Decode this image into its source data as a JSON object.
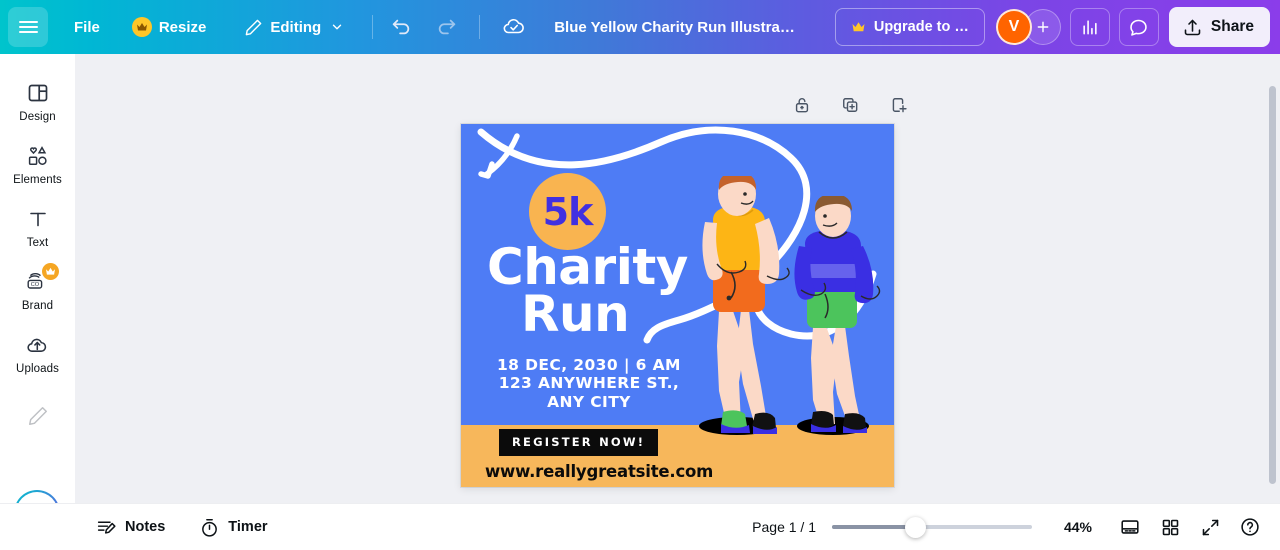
{
  "topbar": {
    "menu_icon": "hamburger-menu-icon",
    "file_label": "File",
    "resize_label": "Resize",
    "resize_pro_icon": "crown-icon",
    "editing_label": "Editing",
    "editing_icon": "pencil-icon",
    "editing_chevron": "chevron-down-icon",
    "undo_icon": "undo-icon",
    "redo_icon": "redo-icon",
    "cloud_icon": "cloud-saved-check-icon",
    "doc_title": "Blue Yellow Charity Run Illustrativ…",
    "upgrade_label": "Upgrade to …",
    "upgrade_icon": "crown-icon",
    "avatar_initial": "V",
    "add_collaborator_icon": "plus-icon",
    "insights_icon": "bar-chart-icon",
    "comment_icon": "speech-bubble-icon",
    "share_label": "Share",
    "share_icon": "upload-share-icon",
    "gradient_start": "#00C4CC",
    "gradient_end": "#8B3DEA"
  },
  "sidebar": {
    "items": [
      {
        "label": "Design",
        "icon": "design-layout-icon",
        "pro": false
      },
      {
        "label": "Elements",
        "icon": "shapes-icon",
        "pro": false
      },
      {
        "label": "Text",
        "icon": "text-t-icon",
        "pro": false
      },
      {
        "label": "Brand",
        "icon": "brand-kit-icon",
        "pro": true
      },
      {
        "label": "Uploads",
        "icon": "upload-cloud-icon",
        "pro": false
      }
    ],
    "draw_icon": "pencil-draw-icon",
    "magic_icon": "magic-sparkles-icon"
  },
  "page_tools": {
    "lock_icon": "unlock-padlock-icon",
    "duplicate_icon": "duplicate-page-icon",
    "add_page_icon": "add-page-icon"
  },
  "poster": {
    "badge": "5k",
    "title_line1": "Charity",
    "title_line2": "Run",
    "date_line": "18 DEC, 2030 | 6 AM",
    "address_line1": "123 ANYWHERE ST.,",
    "address_line2": "ANY CITY",
    "cta": "REGISTER NOW!",
    "url": "www.reallygreatsite.com",
    "colors": {
      "background_blue": "#4E7CF5",
      "ground_orange": "#F7B75B",
      "badge_orange": "#F9B450",
      "badge_text_blue": "#4130E0",
      "cta_black": "#0B0B0B",
      "runner1_shirt": "#FDB515",
      "runner1_shorts": "#F26B1D",
      "runner2_shirt": "#3A2FE3",
      "runner2_shorts": "#4CC45C"
    }
  },
  "bottombar": {
    "notes_label": "Notes",
    "notes_icon": "notes-pencil-icon",
    "timer_label": "Timer",
    "timer_icon": "stopwatch-icon",
    "page_count": "Page 1 / 1",
    "zoom_percent": "44%",
    "grid_view_icon": "page-view-icon",
    "thumbnails_icon": "grid-thumbnails-icon",
    "fullscreen_icon": "expand-fullscreen-icon",
    "help_icon": "help-question-icon"
  }
}
